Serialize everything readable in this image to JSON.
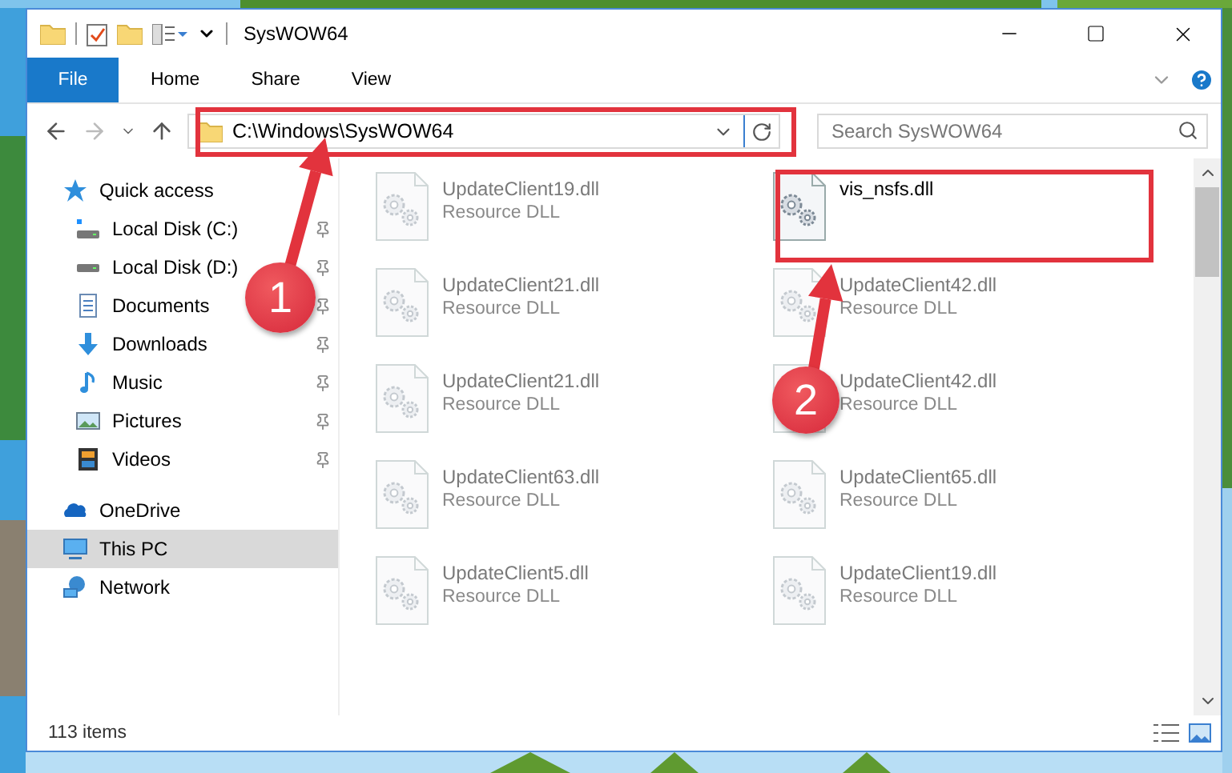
{
  "window": {
    "title": "SysWOW64"
  },
  "ribbon_tabs": [
    {
      "label": "File",
      "kind": "menu"
    },
    {
      "label": "Home",
      "kind": "tab"
    },
    {
      "label": "Share",
      "kind": "tab"
    },
    {
      "label": "View",
      "kind": "tab"
    }
  ],
  "address_bar": {
    "path": "C:\\Windows\\SysWOW64"
  },
  "search": {
    "placeholder": "Search SysWOW64"
  },
  "navigation": [
    {
      "label": "Quick access",
      "kind": "star",
      "selected": false,
      "children": [
        {
          "label": "Local Disk (C:)",
          "kind": "system-drive",
          "pinned": true
        },
        {
          "label": "Local Disk (D:)",
          "kind": "drive",
          "pinned": true
        },
        {
          "label": "Documents",
          "kind": "documents",
          "pinned": true
        },
        {
          "label": "Downloads",
          "kind": "downloads",
          "pinned": true
        },
        {
          "label": "Music",
          "kind": "music",
          "pinned": true
        },
        {
          "label": "Pictures",
          "kind": "pictures",
          "pinned": true
        },
        {
          "label": "Videos",
          "kind": "videos",
          "pinned": true
        }
      ]
    },
    {
      "label": "OneDrive",
      "kind": "cloud",
      "selected": false
    },
    {
      "label": "This PC",
      "kind": "computer",
      "selected": true
    },
    {
      "label": "Network",
      "kind": "network",
      "selected": false
    }
  ],
  "files": [
    {
      "name": "UpdateClient19.dll",
      "type": "Resource DLL",
      "blurred": true
    },
    {
      "name": "vis_nsfs.dll",
      "blurred": false
    },
    {
      "name": "UpdateClient21.dll",
      "type": "Resource DLL",
      "blurred": true
    },
    {
      "name": "UpdateClient42.dll",
      "type": "Resource DLL",
      "blurred": true
    },
    {
      "name": "UpdateClient21.dll",
      "type": "Resource DLL",
      "blurred": true
    },
    {
      "name": "UpdateClient42.dll",
      "type": "Resource DLL",
      "blurred": true
    },
    {
      "name": "UpdateClient63.dll",
      "type": "Resource DLL",
      "blurred": true
    },
    {
      "name": "UpdateClient65.dll",
      "type": "Resource DLL",
      "blurred": true
    },
    {
      "name": "UpdateClient5.dll",
      "type": "Resource DLL",
      "blurred": true
    },
    {
      "name": "UpdateClient19.dll",
      "type": "Resource DLL",
      "blurred": true
    }
  ],
  "status_bar": {
    "item_count": "113 items"
  },
  "annotations": [
    {
      "number": "1"
    },
    {
      "number": "2"
    }
  ]
}
